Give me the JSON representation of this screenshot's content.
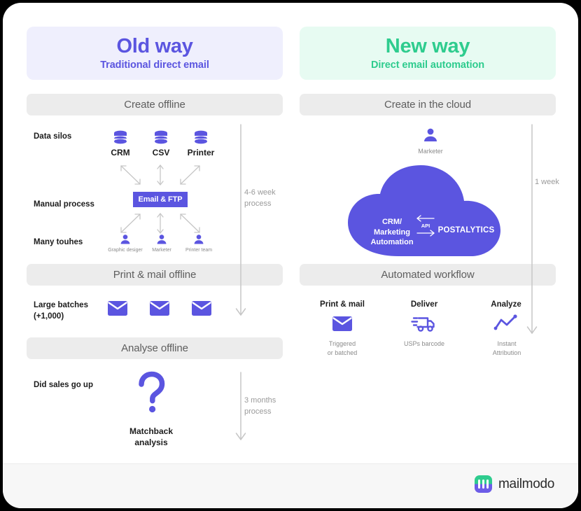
{
  "colors": {
    "purple": "#5B55E0",
    "green": "#2ECC8E",
    "purple_panel": "#EFEFFD",
    "green_panel": "#E7FBF2",
    "bar_gray": "#ECECEC",
    "arrow_gray": "#C4C4C4",
    "muted_text": "#9A9A9A"
  },
  "old_way": {
    "title": "Old way",
    "subtitle": "Traditional direct email",
    "bars": {
      "create": "Create offline",
      "print": "Print & mail offline",
      "analyse": "Analyse offline"
    },
    "row_labels": {
      "data_silos": "Data silos",
      "manual_process": "Manual process",
      "many_touches": "Many touhes",
      "large_batches": "Large batches\n(+1,000)",
      "did_sales": "Did sales go up"
    },
    "silos": [
      "CRM",
      "CSV",
      "Printer"
    ],
    "hub_badge": "Email & FTP",
    "touch_roles": [
      "Graphic desiger",
      "Marketer",
      "Printer team"
    ],
    "matchback_caption": "Matchback\nanalysis",
    "process_note_top": "4-6 week\nprocess",
    "process_note_bottom": "3 months\nprocess"
  },
  "new_way": {
    "title": "New way",
    "subtitle": "Direct email automation",
    "bars": {
      "create": "Create in the cloud",
      "workflow": "Automated workflow"
    },
    "marketer_label": "Marketer",
    "cloud": {
      "left_label": "CRM/\nMarketing\nAutomation",
      "api_label": "API",
      "right_label": "POSTALYTICS"
    },
    "steps": [
      {
        "heading": "Print & mail",
        "icon": "envelope-icon",
        "caption": "Triggered\nor batched"
      },
      {
        "heading": "Deliver",
        "icon": "delivery-truck-icon",
        "caption": "USPs barcode"
      },
      {
        "heading": "Analyze",
        "icon": "line-chart-icon",
        "caption": "Instant\nAttribution"
      }
    ],
    "process_note": "1 week"
  },
  "footer": {
    "brand": "mailmodo"
  }
}
